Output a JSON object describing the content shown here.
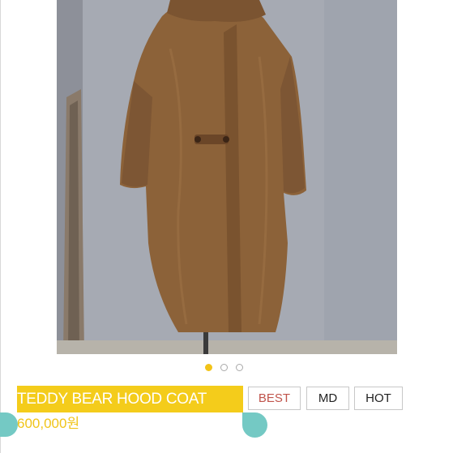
{
  "product": {
    "image_alt": "Teddy bear hood coat on a mannequin",
    "name": "TEDDY BEAR HOOD COAT",
    "price": "600,000원",
    "badges": [
      "BEST",
      "MD",
      "HOT"
    ]
  },
  "carousel": {
    "total_slides": 3,
    "active_slide": 1
  },
  "colors": {
    "highlight": "#f4cc1b",
    "accent_teal": "#74c9c4",
    "best_text": "#c0544b",
    "coat": "#8c6239"
  }
}
